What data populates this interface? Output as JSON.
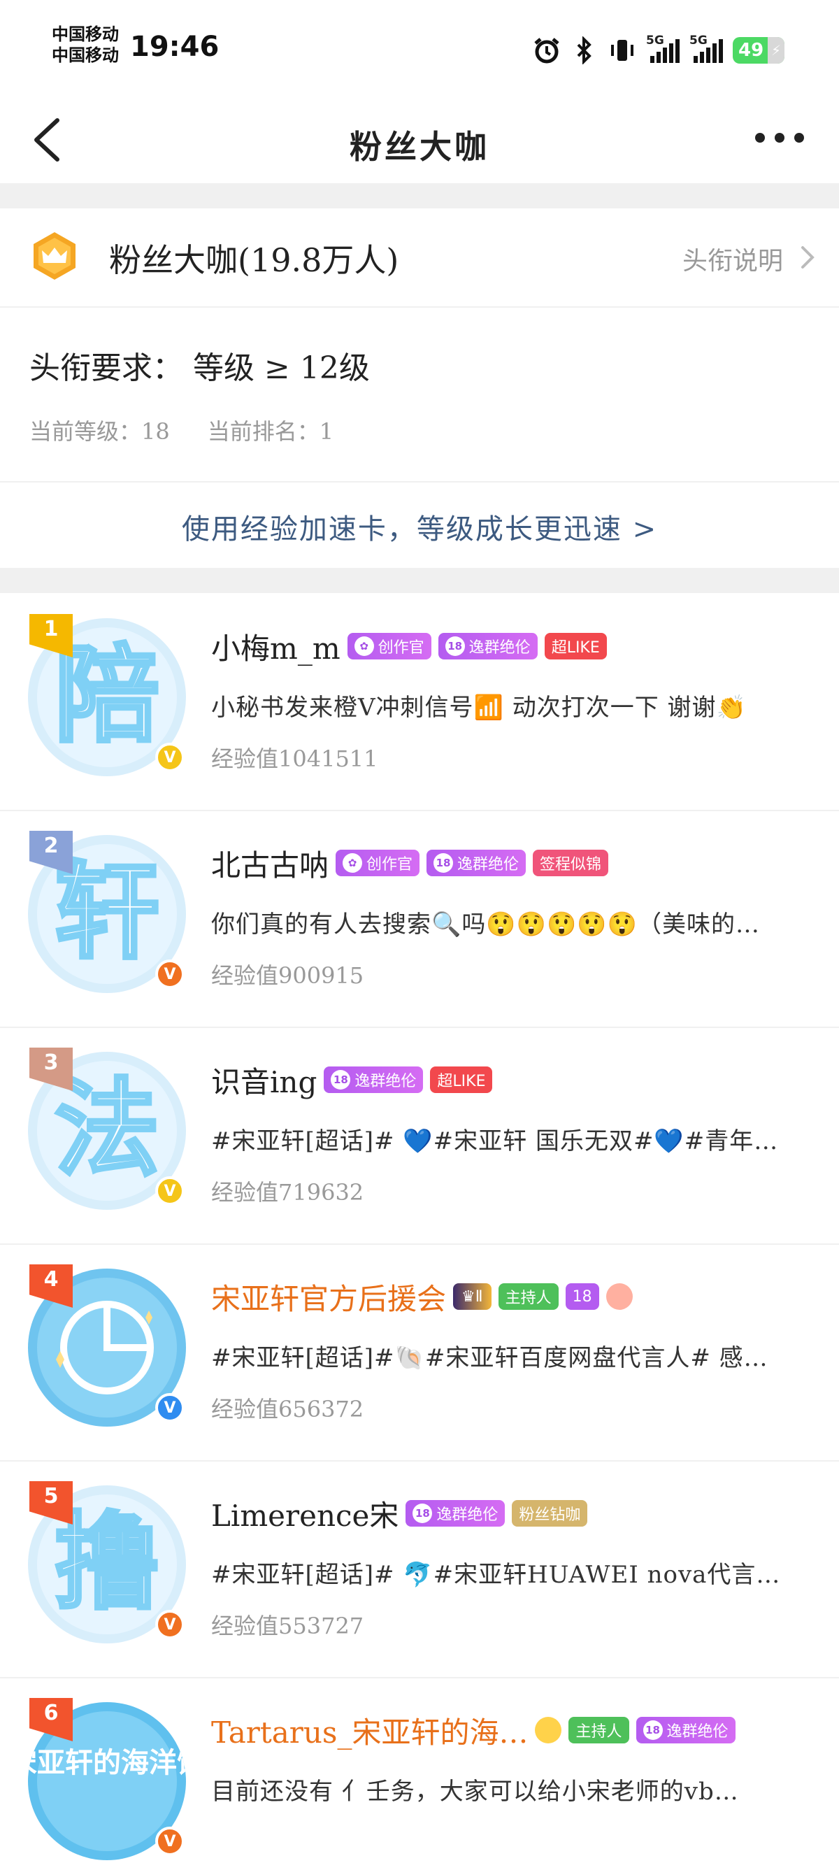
{
  "status": {
    "carrier_top": "中国移动",
    "carrier_bottom": "中国移动",
    "time": "19:46",
    "signal1_label": "5G",
    "signal2_label": "5G",
    "battery": "49",
    "colors": {
      "battery": "#4cd964"
    }
  },
  "nav": {
    "title": "粉丝大咖",
    "back_icon": "chevron-left-icon",
    "more_icon": "more-dots-icon"
  },
  "header": {
    "title": "粉丝大咖(19.8万人)",
    "explain": "头衔说明",
    "requirement": "头衔要求：  等级 ≥ 12级",
    "current_level": "当前等级：18",
    "current_rank": "当前排名：1",
    "boost_text": "使用经验加速卡，等级成长更迅速 >"
  },
  "fans": [
    {
      "rank": "1",
      "avatar_char": "陪",
      "name": "小梅m_m",
      "name_color": "default",
      "tags": [
        "创作官",
        "逸群绝伦",
        "超LIKE"
      ],
      "bio": "小秘书发来橙V冲刺信号📶 动次打次一下 谢谢👏",
      "exp": "经验值1041511",
      "verify": "yellow"
    },
    {
      "rank": "2",
      "avatar_char": "轩",
      "name": "北古古呐",
      "name_color": "default",
      "tags": [
        "创作官",
        "逸群绝伦",
        "签程似锦"
      ],
      "bio": "你们真的有人去搜索🔍吗😲😲😲😲😲（美味的…",
      "exp": "经验值900915",
      "verify": "orange"
    },
    {
      "rank": "3",
      "avatar_char": "法",
      "name": "识音ing",
      "name_color": "default",
      "tags": [
        "逸群绝伦",
        "超LIKE"
      ],
      "bio": "#宋亚轩[超话]# 💙#宋亚轩 国乐无双#💙#青年…",
      "exp": "经验值719632",
      "verify": "yellow"
    },
    {
      "rank": "4",
      "avatar_char": "",
      "name": "宋亚轩官方后援会",
      "name_color": "orange",
      "tags": [
        "Ⅱ",
        "主持人",
        "18"
      ],
      "bio": "#宋亚轩[超话]#🐚#宋亚轩百度网盘代言人# 感…",
      "exp": "经验值656372",
      "verify": "blue"
    },
    {
      "rank": "5",
      "avatar_char": "撸",
      "name": "Limerence宋",
      "name_color": "default",
      "tags": [
        "逸群绝伦",
        "粉丝钻咖"
      ],
      "bio": "#宋亚轩[超话]#  🐬#宋亚轩HUAWEI nova代言…",
      "exp": "经验值553727",
      "verify": "orange"
    },
    {
      "rank": "6",
      "avatar_char": "宋亚轩的海洋馆",
      "name": "Tartarus_宋亚轩的海…",
      "name_color": "orange",
      "tags": [
        "主持人",
        "逸群绝伦"
      ],
      "bio": "目前还没有 亻壬务，大家可以给小宋老师的vb…",
      "exp": "",
      "verify": "orange"
    }
  ]
}
